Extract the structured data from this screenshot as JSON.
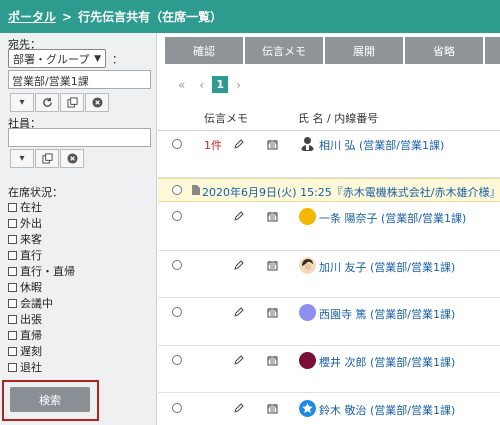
{
  "header": {
    "portal_link": "ポータル",
    "separator": ">",
    "title": "行先伝言共有（在席一覧）"
  },
  "sidebar": {
    "destination_label": "宛先：",
    "group_select": "部署・グループ",
    "colon": "：",
    "group_value": "営業部/営業1課",
    "employee_label": "社員：",
    "employee_value": "",
    "status_label": "在席状況：",
    "statuses": [
      "在社",
      "外出",
      "来客",
      "直行",
      "直行・直帰",
      "休暇",
      "会議中",
      "出張",
      "直帰",
      "遅刻",
      "退社"
    ],
    "search_button": "検索"
  },
  "toolbar": {
    "confirm": "確認",
    "memo": "伝言メモ",
    "expand": "展開",
    "omit": "省略"
  },
  "pager": {
    "first": "«",
    "prev": "‹",
    "current": "1",
    "next": "›"
  },
  "table": {
    "col_memo": "伝言メモ",
    "col_name": "氏 名 / 内線番号",
    "rows": [
      {
        "memo": "1件",
        "name": "相川 弘 (営業部/営業1課)",
        "avatar": "person-photo",
        "avatar_color": "#444444"
      },
      {
        "memo": "",
        "name": "一条 陽奈子 (営業部/営業1課)",
        "avatar": "circle",
        "avatar_color": "#f5b800"
      },
      {
        "memo": "",
        "name": "加川 友子 (営業部/営業1課)",
        "avatar": "person-photo",
        "avatar_color": "#c8a070"
      },
      {
        "memo": "",
        "name": "西園寺 篤 (営業部/営業1課)",
        "avatar": "circle",
        "avatar_color": "#8c8ef0"
      },
      {
        "memo": "",
        "name": "櫻井 次郎 (営業部/営業1課)",
        "avatar": "circle",
        "avatar_color": "#7a1036"
      },
      {
        "memo": "",
        "name": "鈴木 敬治 (営業部/営業1課)",
        "avatar": "star",
        "avatar_color": "#1e88e5"
      }
    ],
    "notice": "2020年6月9日(火) 15:25『赤木電機株式会社/赤木雄介様』"
  },
  "colors": {
    "accent": "#2d9c8f",
    "button_gray": "#8f9499",
    "link": "#1a5fa8",
    "highlight_border": "#b22222"
  }
}
